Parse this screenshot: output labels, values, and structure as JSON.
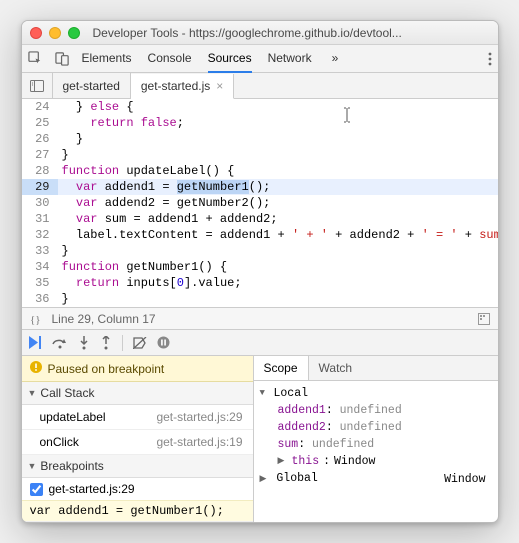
{
  "window": {
    "title": "Developer Tools - https://googlechrome.github.io/devtool..."
  },
  "panels": {
    "items": [
      "Elements",
      "Console",
      "Sources",
      "Network"
    ],
    "active": "Sources",
    "overflow": "»"
  },
  "file_tabs": {
    "items": [
      {
        "name": "get-started",
        "closable": false,
        "active": false
      },
      {
        "name": "get-started.js",
        "closable": true,
        "active": true
      }
    ]
  },
  "code": {
    "lines": [
      {
        "n": 24,
        "html": "  } <span class='kw'>else</span> {",
        "hl": false
      },
      {
        "n": 25,
        "html": "    <span class='kw'>return</span> <span class='kw'>false</span>;",
        "hl": false
      },
      {
        "n": 26,
        "html": "  }",
        "hl": false
      },
      {
        "n": 27,
        "html": "}",
        "hl": false
      },
      {
        "n": 28,
        "html": "<span class='kw'>function</span> <span class='fn'>updateLabel</span>() {",
        "hl": false
      },
      {
        "n": 29,
        "html": "  <span class='kw'>var</span> addend1 = <span class='token-hl'>getNumber1</span>();",
        "hl": true
      },
      {
        "n": 30,
        "html": "  <span class='kw'>var</span> addend2 = getNumber2();",
        "hl": false
      },
      {
        "n": 31,
        "html": "  <span class='kw'>var</span> sum = addend1 + addend2;",
        "hl": false
      },
      {
        "n": 32,
        "html": "  label.textContent = addend1 + <span class='str'>' + '</span> + addend2 + <span class='str'>' = '</span> + <span class='truncated'>sum</span>",
        "hl": false
      },
      {
        "n": 33,
        "html": "}",
        "hl": false
      },
      {
        "n": 34,
        "html": "<span class='kw'>function</span> <span class='fn'>getNumber1</span>() {",
        "hl": false
      },
      {
        "n": 35,
        "html": "  <span class='kw'>return</span> inputs[<span class='num'>0</span>].value;",
        "hl": false
      },
      {
        "n": 36,
        "html": "}",
        "hl": false
      }
    ]
  },
  "status": {
    "position": "Line 29, Column 17"
  },
  "debugger": {
    "paused_label": "Paused on breakpoint",
    "call_stack_label": "Call Stack",
    "stack": [
      {
        "fn": "updateLabel",
        "loc": "get-started.js:29"
      },
      {
        "fn": "onClick",
        "loc": "get-started.js:19"
      }
    ],
    "breakpoints_label": "Breakpoints",
    "breakpoints": [
      {
        "checked": true,
        "label": "get-started.js:29",
        "code": "var addend1 = getNumber1();"
      }
    ]
  },
  "scope": {
    "tabs": [
      "Scope",
      "Watch"
    ],
    "active": "Scope",
    "local_label": "Local",
    "local": [
      {
        "name": "addend1",
        "value": "undefined"
      },
      {
        "name": "addend2",
        "value": "undefined"
      },
      {
        "name": "sum",
        "value": "undefined"
      }
    ],
    "this_label": "this",
    "this_value": "Window",
    "global_label": "Global",
    "global_value": "Window"
  }
}
